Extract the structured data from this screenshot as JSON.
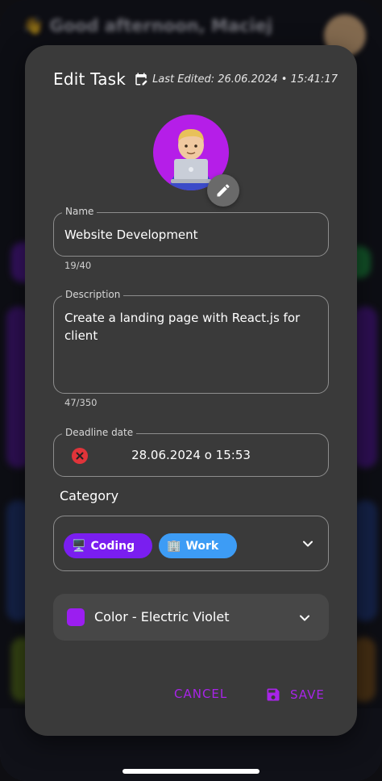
{
  "background": {
    "greeting": "👋 Good afternoon, Maciej"
  },
  "dialog": {
    "title": "Edit Task",
    "last_edited": "Last Edited: 26.06.2024 • 15:41:17",
    "avatar_emoji": "👨🏼‍💻"
  },
  "name_field": {
    "label": "Name",
    "value": "Website Development",
    "counter": "19/40"
  },
  "description_field": {
    "label": "Description",
    "value": "Create a landing page with React.js for client",
    "counter": "47/350"
  },
  "deadline_field": {
    "label": "Deadline date",
    "value": "28.06.2024 o 15:53"
  },
  "category": {
    "title": "Category",
    "chips": [
      {
        "emoji": "🖥️",
        "label": "Coding",
        "color": "#7a1ef0"
      },
      {
        "emoji": "🏢",
        "label": "Work",
        "color": "#3d9cf5"
      }
    ]
  },
  "color_select": {
    "label": "Color - Electric Violet",
    "swatch": "#9b1ef0"
  },
  "actions": {
    "cancel": "CANCEL",
    "save": "SAVE",
    "accent": "#a824e8"
  }
}
